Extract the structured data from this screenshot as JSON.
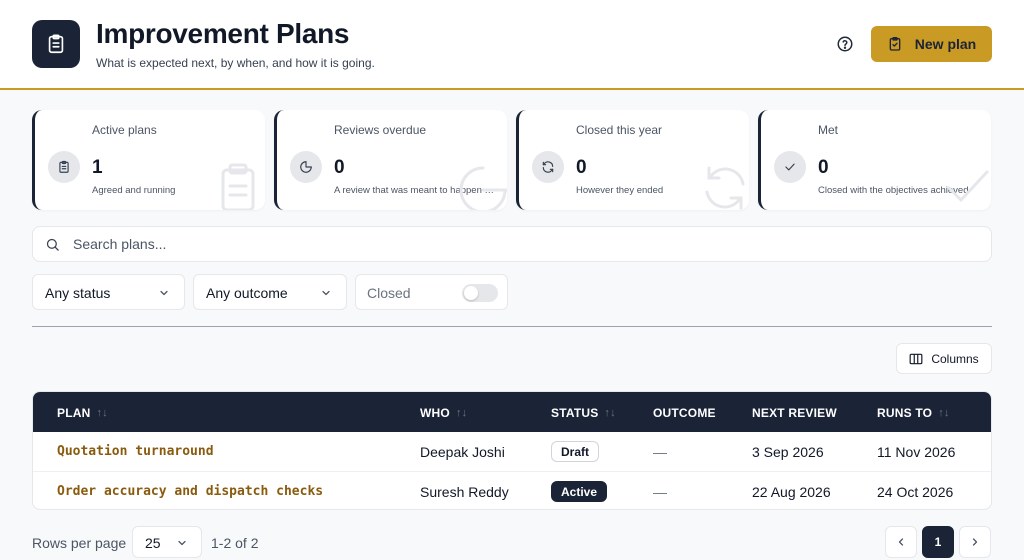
{
  "header": {
    "title": "Improvement Plans",
    "subtitle": "What is expected next, by when, and how it is going.",
    "app_icon": "clipboard-icon",
    "help_icon": "help-circle-icon",
    "new_plan_label": "New plan",
    "new_plan_icon": "clipboard-check-icon"
  },
  "stats": [
    {
      "label": "Active plans",
      "value": "1",
      "caption": "Agreed and running",
      "icon": "clipboard-icon"
    },
    {
      "label": "Reviews overdue",
      "value": "0",
      "caption": "A review that was meant to happen has passed",
      "icon": "pie-clock-icon"
    },
    {
      "label": "Closed this year",
      "value": "0",
      "caption": "However they ended",
      "icon": "refresh-icon"
    },
    {
      "label": "Met",
      "value": "0",
      "caption": "Closed with the objectives achieved",
      "icon": "check-icon"
    }
  ],
  "search": {
    "placeholder": "Search plans..."
  },
  "filters": {
    "status": "Any status",
    "outcome": "Any outcome",
    "closed_label": "Closed",
    "closed_on": false
  },
  "columns_label": "Columns",
  "table": {
    "headers": {
      "plan": "PLAN",
      "who": "WHO",
      "status": "STATUS",
      "outcome": "OUTCOME",
      "next_review": "NEXT REVIEW",
      "runs_to": "RUNS TO"
    },
    "rows": [
      {
        "plan": "Quotation turnaround",
        "who": "Deepak Joshi",
        "status": "Draft",
        "outcome": "—",
        "next_review": "3 Sep 2026",
        "runs_to": "11 Nov 2026"
      },
      {
        "plan": "Order accuracy and dispatch checks",
        "who": "Suresh Reddy",
        "status": "Active",
        "outcome": "—",
        "next_review": "22 Aug 2026",
        "runs_to": "24 Oct 2026"
      }
    ]
  },
  "pagination": {
    "rows_per_page_label": "Rows per page",
    "rows_per_page": "25",
    "range": "1-2 of 2",
    "current_page": "1"
  },
  "colors": {
    "navy": "#1b2436",
    "accent": "#c99a24",
    "link": "#8a5a0e"
  }
}
